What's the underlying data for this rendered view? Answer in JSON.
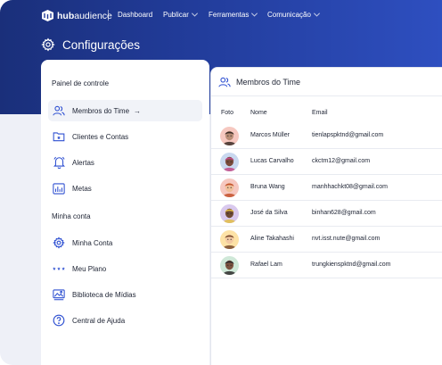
{
  "brand": {
    "name_prefix": "hub",
    "name_suffix": "audience"
  },
  "nav": {
    "items": [
      {
        "label": "Dashboard",
        "dropdown": false
      },
      {
        "label": "Publicar",
        "dropdown": true
      },
      {
        "label": "Ferramentas",
        "dropdown": true
      },
      {
        "label": "Comunicação",
        "dropdown": true
      }
    ]
  },
  "page": {
    "title": "Configurações"
  },
  "sidebar": {
    "sections": [
      {
        "label": "Painel de controle"
      },
      {
        "label": "Minha conta"
      }
    ],
    "items": [
      {
        "label": "Membros do Time",
        "icon": "users-icon",
        "active": true,
        "arrow": "→"
      },
      {
        "label": "Clientes e Contas",
        "icon": "client-folder-icon",
        "active": false
      },
      {
        "label": "Alertas",
        "icon": "bell-icon",
        "active": false
      },
      {
        "label": "Metas",
        "icon": "bar-chart-icon",
        "active": false
      },
      {
        "label": "Minha Conta",
        "icon": "gear-icon",
        "active": false
      },
      {
        "label": "Meu Plano",
        "icon": "stars-icon",
        "active": false
      },
      {
        "label": "Biblioteca de Mídias",
        "icon": "media-library-icon",
        "active": false
      },
      {
        "label": "Central de Ajuda",
        "icon": "help-icon",
        "active": false
      }
    ]
  },
  "members": {
    "title": "Membros do Time",
    "columns": [
      "Foto",
      "Nome",
      "Email"
    ],
    "rows": [
      {
        "name": "Marcos Müller",
        "email": "tienlapspktnd@gmail.com",
        "avatar_bg": "#f6c8c0",
        "skin": "#b98d76",
        "hair": "#3b2c26"
      },
      {
        "name": "Lucas Carvalho",
        "email": "ckctm12@gmail.com",
        "avatar_bg": "#c9d8ef",
        "skin": "#7a4b3b",
        "hair": "#c24a87"
      },
      {
        "name": "Bruna Wang",
        "email": "manhhachkt08@gmail.com",
        "avatar_bg": "#f6c8c0",
        "skin": "#f0c09a",
        "hair": "#c3502a"
      },
      {
        "name": "José da Silva",
        "email": "binhan628@gmail.com",
        "avatar_bg": "#d9c9ee",
        "skin": "#6f4a35",
        "hair": "#e2bd45"
      },
      {
        "name": "Aline Takahashi",
        "email": "nvt.isst.nute@gmail.com",
        "avatar_bg": "#fde2a6",
        "skin": "#f3c9a2",
        "hair": "#7a4a2b"
      },
      {
        "name": "Rafael Lam",
        "email": "trungkienspktnd@gmail.com",
        "avatar_bg": "#cfe8d8",
        "skin": "#7b5340",
        "hair": "#2c2a2a"
      }
    ]
  },
  "colors": {
    "brand_dark": "#1a2f7a",
    "brand_light": "#2e4fc0",
    "accent_icon": "#2d4fd1"
  }
}
